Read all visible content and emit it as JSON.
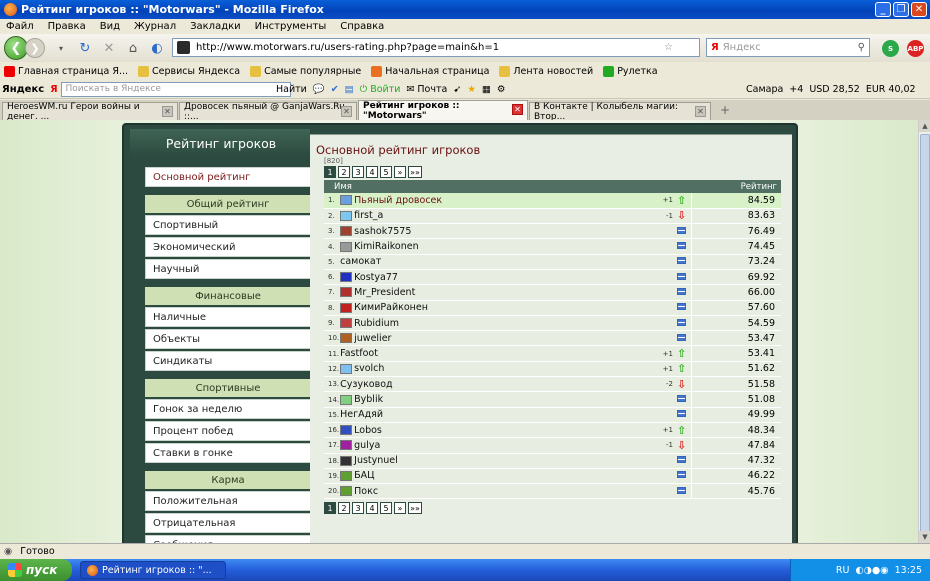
{
  "window": {
    "title": "Рейтинг игроков :: \"Motorwars\" - Mozilla Firefox"
  },
  "menu": [
    "Файл",
    "Правка",
    "Вид",
    "Журнал",
    "Закладки",
    "Инструменты",
    "Справка"
  ],
  "nav": {
    "url": "http://www.motorwars.ru/users-rating.php?page=main&h=1",
    "search_placeholder": "Яндекс"
  },
  "bookmarks": [
    "Главная страница Я...",
    "Сервисы Яндекса",
    "Самые популярные",
    "Начальная страница",
    "Лента новостей",
    "Рулетка"
  ],
  "yandex_bar": {
    "logo": "Яндекс",
    "search_placeholder": "Поискать в Яндексе",
    "find": "Найти",
    "login": "Войти",
    "mail": "Почта",
    "city": "Самара",
    "temp": "+4",
    "usd": "USD 28,52",
    "eur": "EUR 40,02"
  },
  "tabs": [
    {
      "label": "HeroesWM.ru Герои войны и денег. ...",
      "active": false
    },
    {
      "label": "Дровосек пьяный @ GanjaWars.Ru ::...",
      "active": false
    },
    {
      "label": "Рейтинг игроков :: \"Motorwars\"",
      "active": true
    },
    {
      "label": "В Контакте | Колыбель магии: Втор...",
      "active": false
    }
  ],
  "page": {
    "left_title": "Рейтинг игроков",
    "menu_main": "Основной рейтинг",
    "sections": [
      {
        "title": "Общий рейтинг",
        "items": [
          "Спортивный",
          "Экономический",
          "Научный"
        ]
      },
      {
        "title": "Финансовые",
        "items": [
          "Наличные",
          "Объекты",
          "Синдикаты"
        ]
      },
      {
        "title": "Спортивные",
        "items": [
          "Гонок за неделю",
          "Процент побед",
          "Ставки в гонке"
        ]
      },
      {
        "title": "Карма",
        "items": [
          "Положительная",
          "Отрицательная",
          "Сообщения"
        ]
      }
    ],
    "right_title": "Основной рейтинг игроков",
    "count": "[820]",
    "pager": [
      "1",
      "2",
      "3",
      "4",
      "5",
      "»",
      "»»"
    ],
    "col_name": "Имя",
    "col_rating": "Рейтинг",
    "rows": [
      {
        "n": "1.",
        "name": "Пьяный дровосек",
        "chg": "+1",
        "dir": "up",
        "score": "84.59",
        "av": "#6aa0e0"
      },
      {
        "n": "2.",
        "name": "first_a",
        "chg": "-1",
        "dir": "down",
        "score": "83.63",
        "av": "#7cc8f0"
      },
      {
        "n": "3.",
        "name": "sashok7575",
        "chg": "",
        "dir": "eq",
        "score": "76.49",
        "av": "#a04030"
      },
      {
        "n": "4.",
        "name": "KimiRaikonen",
        "chg": "",
        "dir": "eq",
        "score": "74.45",
        "av": "#999"
      },
      {
        "n": "5.",
        "name": "самокат",
        "chg": "",
        "dir": "eq",
        "score": "73.24",
        "av": ""
      },
      {
        "n": "6.",
        "name": "Kostya77",
        "chg": "",
        "dir": "eq",
        "score": "69.92",
        "av": "#2030c0"
      },
      {
        "n": "7.",
        "name": "Mr_President",
        "chg": "",
        "dir": "eq",
        "score": "66.00",
        "av": "#b03030"
      },
      {
        "n": "8.",
        "name": "КимиРайконен",
        "chg": "",
        "dir": "eq",
        "score": "57.60",
        "av": "#c02020"
      },
      {
        "n": "9.",
        "name": "Rubidium",
        "chg": "",
        "dir": "eq",
        "score": "54.59",
        "av": "#c04040"
      },
      {
        "n": "10.",
        "name": "juwelier",
        "chg": "",
        "dir": "eq",
        "score": "53.47",
        "av": "#b06020"
      },
      {
        "n": "11.",
        "name": "Fastfoot",
        "chg": "+1",
        "dir": "up",
        "score": "53.41",
        "av": ""
      },
      {
        "n": "12.",
        "name": "svolch",
        "chg": "+1",
        "dir": "up",
        "score": "51.62",
        "av": "#80c0f0"
      },
      {
        "n": "13.",
        "name": "Сузуковод",
        "chg": "-2",
        "dir": "down",
        "score": "51.58",
        "av": ""
      },
      {
        "n": "14.",
        "name": "Byblik",
        "chg": "",
        "dir": "eq",
        "score": "51.08",
        "av": "#80d080"
      },
      {
        "n": "15.",
        "name": "НегАдяй",
        "chg": "",
        "dir": "eq",
        "score": "49.99",
        "av": ""
      },
      {
        "n": "16.",
        "name": "Lobos",
        "chg": "+1",
        "dir": "up",
        "score": "48.34",
        "av": "#3050c0"
      },
      {
        "n": "17.",
        "name": "gulya",
        "chg": "-1",
        "dir": "down",
        "score": "47.84",
        "av": "#a020a0"
      },
      {
        "n": "18.",
        "name": "Justynuel",
        "chg": "",
        "dir": "eq",
        "score": "47.32",
        "av": "#333"
      },
      {
        "n": "19.",
        "name": "БАЦ",
        "chg": "",
        "dir": "eq",
        "score": "46.22",
        "av": "#60a030"
      },
      {
        "n": "20.",
        "name": "Покс",
        "chg": "",
        "dir": "eq",
        "score": "45.76",
        "av": "#60a030"
      }
    ]
  },
  "status": "Готово",
  "taskbar": {
    "start": "пуск",
    "task": "Рейтинг игроков :: \"...",
    "lang": "RU",
    "time": "13:25"
  }
}
